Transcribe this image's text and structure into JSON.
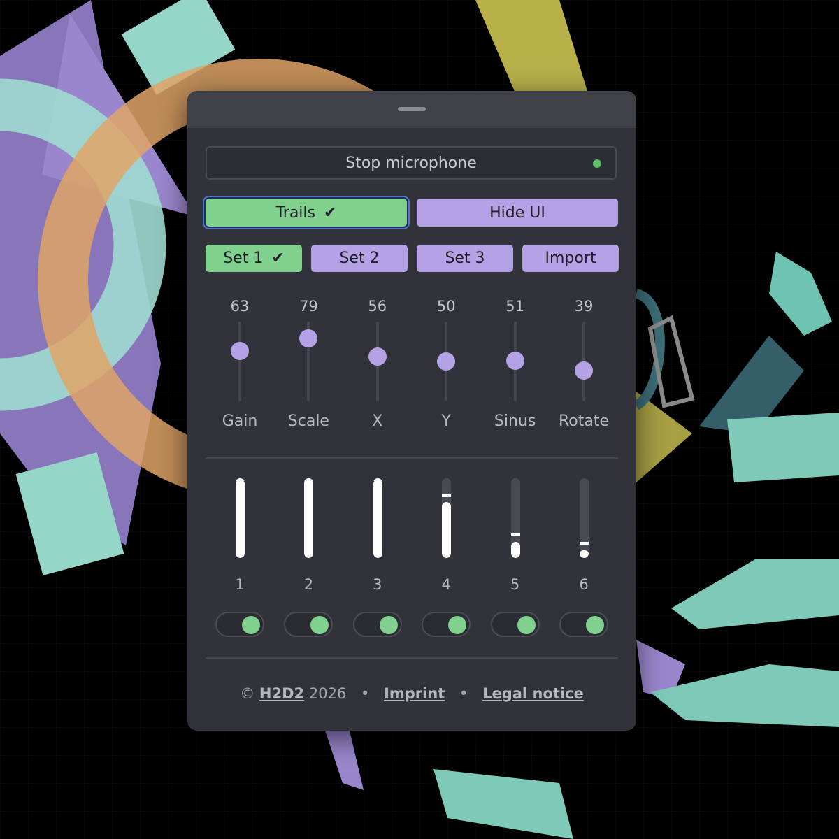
{
  "colors": {
    "panel": "#32323b",
    "accent_green": "#80d08e",
    "accent_purple": "#b5a2e6",
    "led": "#5fbf6a"
  },
  "mic_button": {
    "label": "Stop microphone",
    "led_icon": "status-dot-icon"
  },
  "trails_button": {
    "label": "Trails",
    "checked": true
  },
  "hide_ui_button": {
    "label": "Hide UI"
  },
  "sets": [
    {
      "label": "Set 1",
      "active": true
    },
    {
      "label": "Set 2",
      "active": false
    },
    {
      "label": "Set 3",
      "active": false
    },
    {
      "label": "Import",
      "active": false
    }
  ],
  "sliders": [
    {
      "label": "Gain",
      "value": "63"
    },
    {
      "label": "Scale",
      "value": "79"
    },
    {
      "label": "X",
      "value": "56"
    },
    {
      "label": "Y",
      "value": "50"
    },
    {
      "label": "Sinus",
      "value": "51"
    },
    {
      "label": "Rotate",
      "value": "39"
    }
  ],
  "channels": [
    {
      "label": "1",
      "level": 0.98,
      "peak": 1.0,
      "enabled": true
    },
    {
      "label": "2",
      "level": 1.0,
      "peak": 1.0,
      "enabled": true
    },
    {
      "label": "3",
      "level": 0.98,
      "peak": 1.0,
      "enabled": true
    },
    {
      "label": "4",
      "level": 0.7,
      "peak": 0.8,
      "enabled": true
    },
    {
      "label": "5",
      "level": 0.2,
      "peak": 0.31,
      "enabled": true
    },
    {
      "label": "6",
      "level": 0.1,
      "peak": 0.2,
      "enabled": true
    }
  ],
  "footer": {
    "copyright": "©",
    "brand": "H2D2",
    "year": "2026",
    "separator": "•",
    "imprint": "Imprint",
    "legal": "Legal notice"
  }
}
